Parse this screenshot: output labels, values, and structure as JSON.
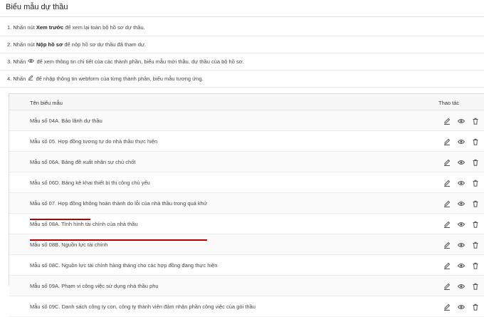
{
  "page": {
    "title": "Biểu mẫu dự thầu"
  },
  "instructions": [
    {
      "prefix": "1. Nhấn nút ",
      "bold": "Xem trước",
      "suffix": " để xem lại toàn bộ hồ sơ dự thầu."
    },
    {
      "prefix": "2. Nhấn nút ",
      "bold": "Nộp hồ sơ",
      "suffix": " để nộp hồ sơ dự thầu đã tham dự."
    },
    {
      "prefix": "3. Nhấn ",
      "icon": "eye-icon",
      "suffix": " để xem thông tin chi tiết của các thành phần, biểu mẫu mời thầu, dự thầu của bộ hồ sơ."
    },
    {
      "prefix": "4. Nhấn ",
      "icon": "pencil-icon",
      "suffix": " để nhập thông tin webform của từng thành phần, biểu mẫu tương ứng."
    }
  ],
  "table": {
    "col_name": "Tên biểu mẫu",
    "col_actions": "Thao tác",
    "rows": [
      {
        "name": "Mẫu số 04A. Bảo lãnh dự thầu"
      },
      {
        "name": "Mẫu số 05. Hợp đồng tương tự do nhà thầu thực hiện"
      },
      {
        "name": "Mẫu số 06A. Bảng đề xuất nhân sự chủ chốt"
      },
      {
        "name": "Mẫu số 06D. Bảng kê khai thiết bị thi công chủ yếu"
      },
      {
        "name": "Mẫu số 07. Hợp đồng không hoàn thành do lỗi của nhà thầu trong quá khứ"
      },
      {
        "name": "Mẫu số 08A. Tình hình tài chính của nhà thầu"
      },
      {
        "name": "Mẫu số 08B. Nguồn lực tài chính"
      },
      {
        "name": "Mẫu số 08C. Nguồn lực tài chính hàng tháng cho các hợp đồng đang thực hiện"
      },
      {
        "name": "Mẫu số 09A. Phạm vi công việc sử dụng nhà thầu phụ"
      },
      {
        "name": "Mẫu số 09C. Danh sách công ty con, công ty thành viên đảm nhận phần công việc của gói thầu"
      }
    ]
  },
  "icons": {
    "edit": "pencil-icon",
    "view": "eye-icon",
    "delete": "trash-icon"
  },
  "colors": {
    "annotation": "#b40000",
    "icon": "#555555",
    "header_bg": "#f7f7f7"
  }
}
